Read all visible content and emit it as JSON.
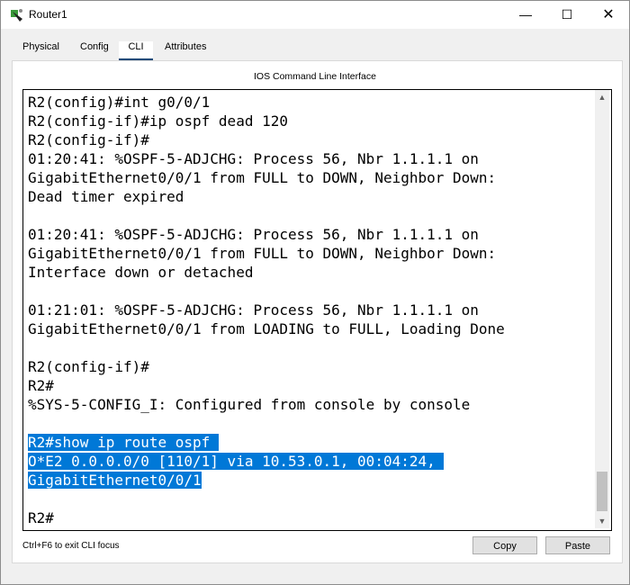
{
  "window": {
    "title": "Router1",
    "controls": {
      "minimize": "—",
      "maximize": "☐",
      "close": "✕"
    }
  },
  "tabs": [
    {
      "label": "Physical",
      "active": false
    },
    {
      "label": "Config",
      "active": false
    },
    {
      "label": "CLI",
      "active": true
    },
    {
      "label": "Attributes",
      "active": false
    }
  ],
  "cli": {
    "title": "IOS Command Line Interface",
    "lines": [
      {
        "text": "R2(config)#int g0/0/1",
        "highlighted": false
      },
      {
        "text": "R2(config-if)#ip ospf dead 120",
        "highlighted": false
      },
      {
        "text": "R2(config-if)#",
        "highlighted": false
      },
      {
        "text": "01:20:41: %OSPF-5-ADJCHG: Process 56, Nbr 1.1.1.1 on",
        "highlighted": false
      },
      {
        "text": "GigabitEthernet0/0/1 from FULL to DOWN, Neighbor Down:",
        "highlighted": false
      },
      {
        "text": "Dead timer expired",
        "highlighted": false
      },
      {
        "text": "",
        "highlighted": false
      },
      {
        "text": "01:20:41: %OSPF-5-ADJCHG: Process 56, Nbr 1.1.1.1 on",
        "highlighted": false
      },
      {
        "text": "GigabitEthernet0/0/1 from FULL to DOWN, Neighbor Down:",
        "highlighted": false
      },
      {
        "text": "Interface down or detached",
        "highlighted": false
      },
      {
        "text": "",
        "highlighted": false
      },
      {
        "text": "01:21:01: %OSPF-5-ADJCHG: Process 56, Nbr 1.1.1.1 on",
        "highlighted": false
      },
      {
        "text": "GigabitEthernet0/0/1 from LOADING to FULL, Loading Done",
        "highlighted": false
      },
      {
        "text": "",
        "highlighted": false
      },
      {
        "text": "R2(config-if)#",
        "highlighted": false
      },
      {
        "text": "R2#",
        "highlighted": false
      },
      {
        "text": "%SYS-5-CONFIG_I: Configured from console by console",
        "highlighted": false
      },
      {
        "text": "",
        "highlighted": false
      },
      {
        "text": "R2#show ip route ospf ",
        "highlighted": true
      },
      {
        "text": "O*E2 0.0.0.0/0 [110/1] via 10.53.0.1, 00:04:24, ",
        "highlighted": true
      },
      {
        "text": "GigabitEthernet0/0/1",
        "highlighted": true
      },
      {
        "text": "",
        "highlighted": false
      },
      {
        "text": "R2#",
        "highlighted": false
      }
    ]
  },
  "footer": {
    "hint": "Ctrl+F6 to exit CLI focus",
    "copy_label": "Copy",
    "paste_label": "Paste"
  },
  "colors": {
    "selection": "#0078d7",
    "tab_underline": "#1e4b7a",
    "icon_green": "#3a9a3a"
  },
  "icons": {
    "app": "router-icon",
    "scroll_up": "▲",
    "scroll_down": "▼"
  }
}
